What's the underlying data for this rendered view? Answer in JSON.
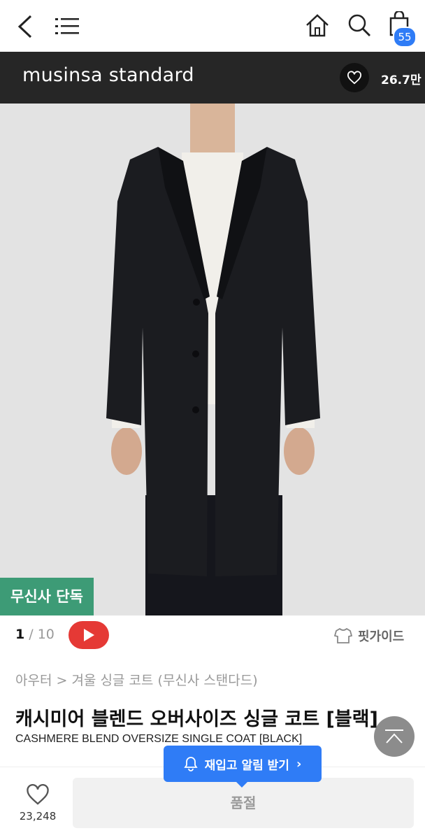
{
  "topnav": {
    "back_icon": "chevron-left-icon",
    "menu_icon": "menu-icon",
    "home_icon": "home-icon",
    "search_icon": "search-icon",
    "cart_icon": "shopping-bag-icon",
    "cart_count": "55"
  },
  "brand": {
    "name": "musinsa standard",
    "like_count": "26.7만"
  },
  "gallery": {
    "exclusive_badge": "무신사 단독",
    "current": "1",
    "separator": " / ",
    "total": "10"
  },
  "fit_guide": {
    "label": "핏가이드"
  },
  "product": {
    "breadcrumb": "아우터 > 겨울 싱글 코트 (무신사 스탠다드)",
    "title_ko": "캐시미어 블렌드 오버사이즈 싱글 코트 [블랙]",
    "title_en": "CASHMERE BLEND OVERSIZE SINGLE COAT [BLACK]"
  },
  "bottom": {
    "wish_count": "23,248",
    "soldout_label": "품절",
    "restock_label": "재입고 알림 받기"
  },
  "colors": {
    "accent_blue": "#2f7cf6",
    "brand_bar": "#262626",
    "exclusive_green": "#3d9b76",
    "youtube_red": "#e53935"
  }
}
